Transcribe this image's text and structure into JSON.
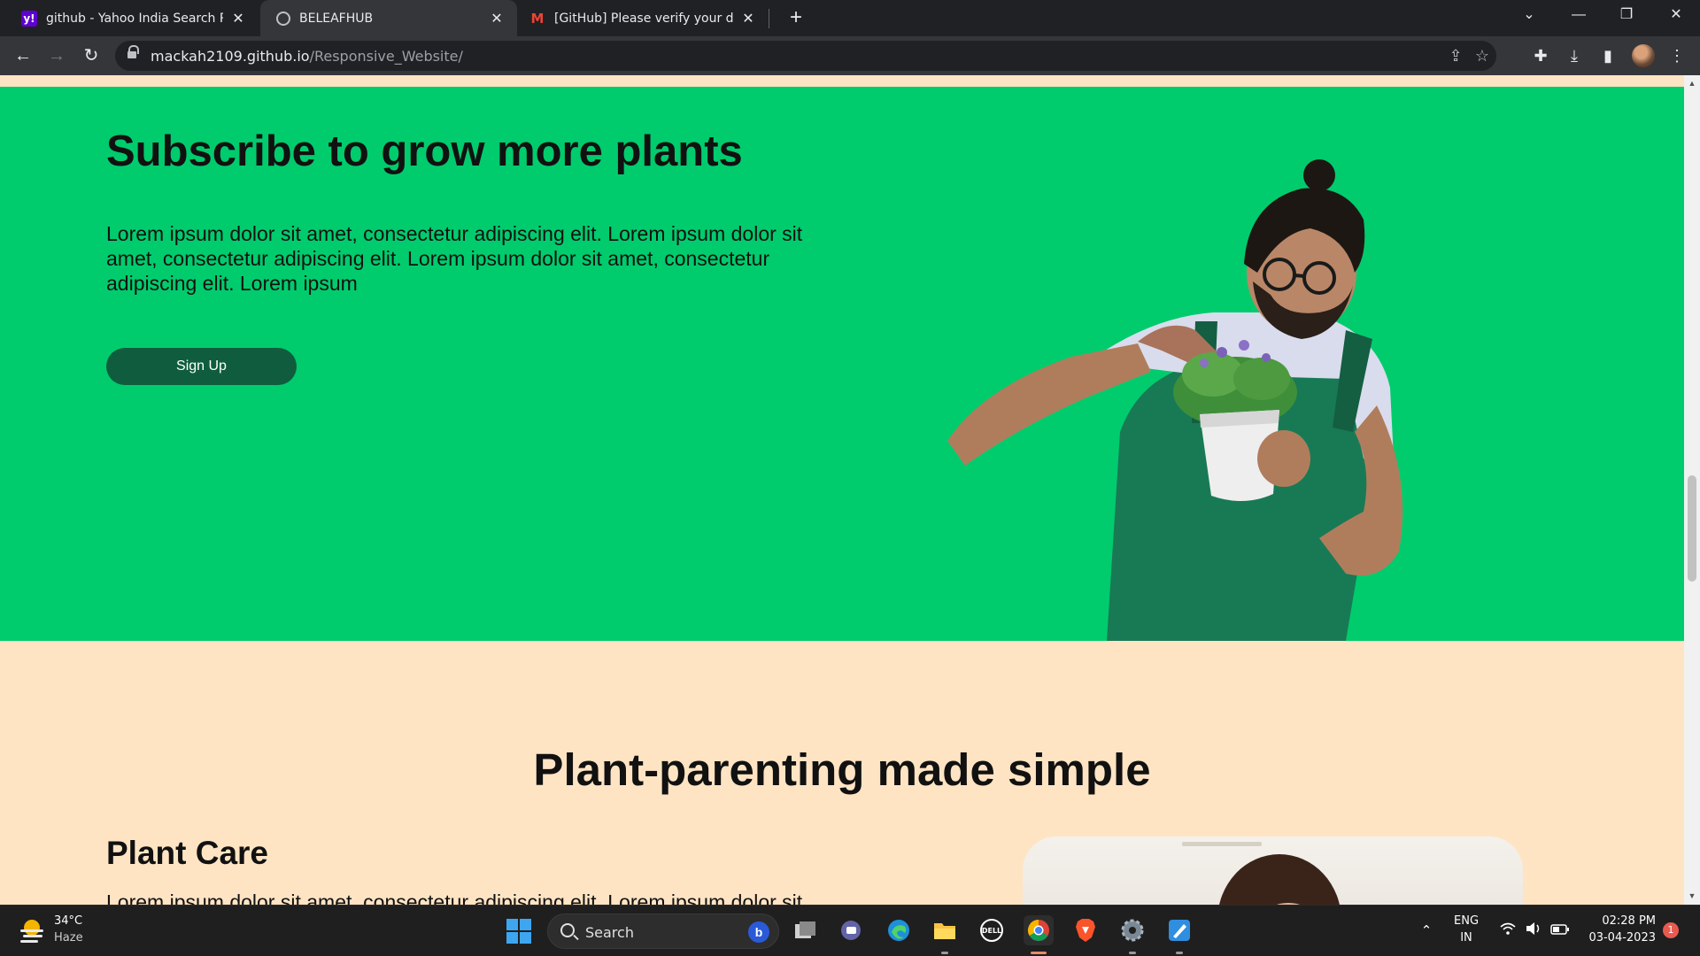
{
  "browser": {
    "tabs": [
      {
        "title": "github - Yahoo India Search Resu",
        "favicon": "yahoo-icon",
        "active": false
      },
      {
        "title": "BELEAFHUB",
        "favicon": "globe-icon",
        "active": true
      },
      {
        "title": "[GitHub] Please verify your devic",
        "favicon": "gmail-icon",
        "active": false
      }
    ],
    "url_host": "mackah2109.github.io",
    "url_path": "/Responsive_Website/"
  },
  "page": {
    "subscribe": {
      "title": "Subscribe to grow more plants",
      "text": "Lorem ipsum dolor sit amet, consectetur adipiscing elit. Lorem ipsum dolor sit amet, consectetur adipiscing elit. Lorem ipsum dolor sit amet, consectetur adipiscing elit. Lorem ipsum",
      "button": "Sign Up"
    },
    "simple_title": "Plant-parenting made simple",
    "care": {
      "title": "Plant Care",
      "text": "Lorem ipsum dolor sit amet, consectetur adipiscing elit. Lorem ipsum dolor sit"
    }
  },
  "taskbar": {
    "weather_temp": "34°C",
    "weather_desc": "Haze",
    "search_label": "Search",
    "lang_top": "ENG",
    "lang_bottom": "IN",
    "time": "02:28 PM",
    "date": "03-04-2023",
    "notification_count": "1"
  },
  "colors": {
    "subscribe_bg": "#00cc6d",
    "page_bg": "#ffe4c4",
    "button_bg": "#0f5d3e"
  }
}
